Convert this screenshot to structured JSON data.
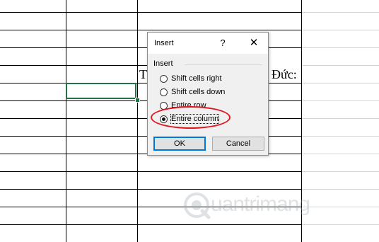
{
  "sheet": {
    "cell_text_left": "T",
    "cell_text_right": "Đức:"
  },
  "dialog": {
    "title": "Insert",
    "help": "?",
    "close": "✕",
    "group_label": "Insert",
    "options": [
      {
        "label": "Shift cells right",
        "checked": false
      },
      {
        "label": "Shift cells down",
        "checked": false
      },
      {
        "label": "Entire row",
        "checked": false
      },
      {
        "label": "Entire column",
        "checked": true
      }
    ],
    "ok_label": "OK",
    "cancel_label": "Cancel",
    "highlight_color": "#e0151f"
  },
  "watermark": {
    "text": "uantrimang",
    "icon": "q-logo-icon"
  }
}
